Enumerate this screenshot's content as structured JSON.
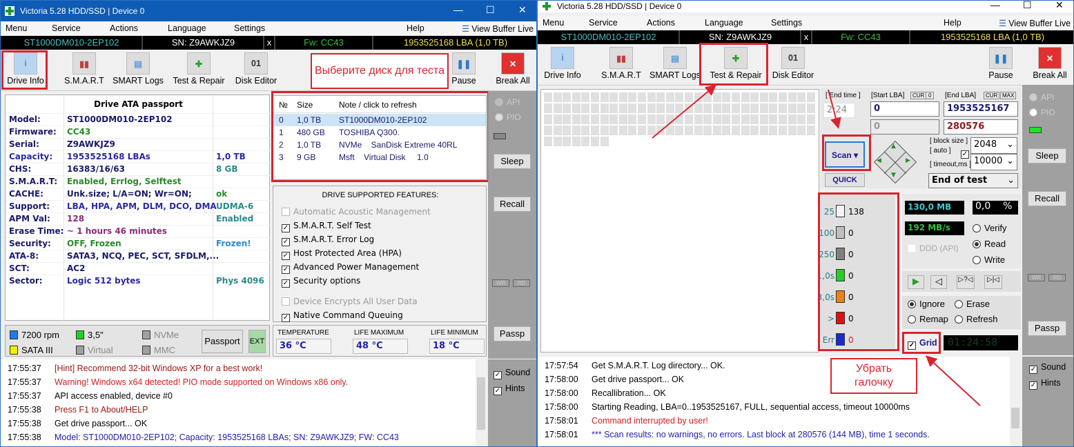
{
  "left": {
    "title": "Victoria 5.28 HDD/SSD | Device 0",
    "menu": [
      "Menu",
      "Service",
      "Actions",
      "Language",
      "Settings",
      "Help"
    ],
    "view_buffer": "View Buffer Live",
    "bar": {
      "model": "ST1000DM010-2EP102",
      "sn": "SN: Z9AWKJZ9",
      "x": "x",
      "fw": "Fw: CC43",
      "lba": "1953525168 LBA (1,0 TB)"
    },
    "toolbar": [
      "Drive Info",
      "S.M.A.R.T",
      "SMART Logs",
      "Test & Repair",
      "Disk Editor"
    ],
    "pause": "Pause",
    "break_all": "Break All",
    "annotation": "Выберите диск для теста",
    "passport": {
      "title": "Drive ATA passport",
      "rows": [
        {
          "k": "Model:",
          "v": "ST1000DM010-2EP102",
          "e": "",
          "kc": "#1a1a6a",
          "vc": "#1a1a6a",
          "ec": ""
        },
        {
          "k": "Firmware:",
          "v": "CC43",
          "e": "",
          "kc": "#1a1a6a",
          "vc": "#2a8a2a",
          "ec": ""
        },
        {
          "k": "Serial:",
          "v": "Z9AWKJZ9",
          "e": "",
          "kc": "#1a1a6a",
          "vc": "#1a1a6a",
          "ec": ""
        },
        {
          "k": "Capacity:",
          "v": "1953525168 LBAs",
          "e": "1,0 TB",
          "kc": "#2a2aa0",
          "vc": "#2a2aa0",
          "ec": "#2a2aa0"
        },
        {
          "k": "CHS:",
          "v": "16383/16/63",
          "e": "8 GB",
          "kc": "#1a1a6a",
          "vc": "#1a1a6a",
          "ec": "#2a8a8a"
        },
        {
          "k": "S.M.A.R.T:",
          "v": "Enabled, Errlog, Selftest",
          "e": "",
          "kc": "#1a1a6a",
          "vc": "#2a8a2a",
          "ec": ""
        },
        {
          "k": "CACHE:",
          "v": "Unk.size; L/A=ON; Wr=ON;",
          "e": "ok",
          "kc": "#1a1a6a",
          "vc": "#1a1a6a",
          "ec": "#2a8a2a"
        },
        {
          "k": "Support:",
          "v": "LBA, HPA, APM, DLM, DCO, DMA",
          "e": "UDMA-6",
          "kc": "#1a1a6a",
          "vc": "#2a2aa0",
          "ec": "#2a8a8a"
        },
        {
          "k": "APM Val:",
          "v": "128",
          "e": "Enabled",
          "kc": "#1a1a6a",
          "vc": "#8a2a7a",
          "ec": "#2a8a8a"
        },
        {
          "k": "Erase Time:",
          "v": "~ 1 hours 46 minutes",
          "e": "",
          "kc": "#1a1a6a",
          "vc": "#8a2a7a",
          "ec": ""
        },
        {
          "k": "Security:",
          "v": "OFF, Frozen",
          "e": "Frozen!",
          "kc": "#1a1a6a",
          "vc": "#2a8a2a",
          "ec": "#2a8ad0"
        },
        {
          "k": "ATA-8:",
          "v": "SATA3, NCQ, PEC, SCT, SFDLM,...",
          "e": "",
          "kc": "#1a1a6a",
          "vc": "#1a1a6a",
          "ec": ""
        },
        {
          "k": "SCT:",
          "v": "AC2",
          "e": "",
          "kc": "#1a1a6a",
          "vc": "#1a1a6a",
          "ec": ""
        },
        {
          "k": "Sector:",
          "v": "Logic 512 bytes",
          "e": "Phys 4096",
          "kc": "#1a1a6a",
          "vc": "#2a2aa0",
          "ec": "#2a8a8a"
        }
      ]
    },
    "disks": {
      "headers": [
        "№",
        "Size",
        "Note / click to refresh"
      ],
      "rows": [
        [
          "0",
          "1,0 TB",
          "ST1000DM010-2EP102"
        ],
        [
          "1",
          "480 GB",
          "TOSHIBA Q300."
        ],
        [
          "2",
          "1,0 TB",
          "NVMe    SanDisk Extreme 40RL"
        ],
        [
          "3",
          "9 GB",
          "Msft    Virtual Disk     1.0"
        ]
      ]
    },
    "features": {
      "title": "DRIVE SUPPORTED FEATURES:",
      "items": [
        {
          "label": "Automatic Acoustic Management",
          "checked": false,
          "enabled": false
        },
        {
          "label": "S.M.A.R.T. Self Test",
          "checked": true,
          "enabled": true
        },
        {
          "label": "S.M.A.R.T. Error Log",
          "checked": true,
          "enabled": true
        },
        {
          "label": "Host Protected Area (HPA)",
          "checked": true,
          "enabled": true
        },
        {
          "label": "Advanced Power Management",
          "checked": true,
          "enabled": true
        },
        {
          "label": "Security options",
          "checked": true,
          "enabled": true
        },
        {
          "label": "Device Encrypts All User Data",
          "checked": false,
          "enabled": false
        },
        {
          "label": "Native Command Queuing",
          "checked": true,
          "enabled": true
        }
      ]
    },
    "side": {
      "api": "API",
      "pio": "PIO",
      "sleep": "Sleep",
      "recall": "Recall",
      "wr": "WR",
      "rd": "RD",
      "passp": "Passp",
      "sound": "Sound",
      "hints": "Hints"
    },
    "legend": [
      {
        "label": "7200 rpm",
        "color": "#1e7be6"
      },
      {
        "label": "SATA III",
        "color": "#f0f000"
      },
      {
        "label": "3,5\"",
        "color": "#22d022"
      },
      {
        "label": "Virtual",
        "color": "#a0a0a0"
      },
      {
        "label": "NVMe",
        "color": "#a0a0a0"
      },
      {
        "label": "MMC",
        "color": "#a0a0a0"
      }
    ],
    "passport_btn": "Passport",
    "ext_btn": "EXT",
    "temps": [
      {
        "label": "TEMPERATURE",
        "value": "36 °C"
      },
      {
        "label": "LIFE MAXIMUM",
        "value": "48 °C"
      },
      {
        "label": "LIFE MINIMUM",
        "value": "18 °C"
      }
    ],
    "log": [
      {
        "t": "17:55:37",
        "m": "[Hint] Recommend 32-bit Windows XP for a best work!",
        "c": "#a01818"
      },
      {
        "t": "17:55:37",
        "m": "Warning! Windows x64 detected! PIO mode supported on Windows x86 only.",
        "c": "#d02020"
      },
      {
        "t": "17:55:37",
        "m": "API access enabled, device #0",
        "c": "#000"
      },
      {
        "t": "17:55:38",
        "m": "Press F1 to About/HELP",
        "c": "#a01818"
      },
      {
        "t": "17:55:38",
        "m": "Get drive passport... OK",
        "c": "#000"
      },
      {
        "t": "17:55:38",
        "m": "Model: ST1000DM010-2EP102; Capacity: 1953525168 LBAs; SN: Z9AWKJZ9; FW: CC43",
        "c": "#2020b0"
      }
    ]
  },
  "right": {
    "title": "Victoria 5.28 HDD/SSD | Device 0",
    "menu": [
      "Menu",
      "Service",
      "Actions",
      "Language",
      "Settings",
      "Help"
    ],
    "view_buffer": "View Buffer Live",
    "bar": {
      "model": "ST1000DM010-2EP102",
      "sn": "SN: Z9AWKJZ9",
      "x": "x",
      "fw": "Fw: CC43",
      "lba": "1953525168 LBA (1,0 TB)"
    },
    "toolbar": [
      "Drive Info",
      "S.M.A.R.T",
      "SMART Logs",
      "Test & Repair",
      "Disk Editor"
    ],
    "pause": "Pause",
    "break_all": "Break All",
    "end_time_label": "[ End time ]",
    "end_time": "2:24",
    "start_lba_label": "[Start LBA]",
    "cur": "CUR",
    "zero": "0",
    "end_lba_label": "[End LBA]",
    "max": "MAX",
    "start_lba": "0",
    "end_lba": "1953525167",
    "cur_lba": "0",
    "cur_end": "280576",
    "scan": "Scan",
    "quick": "QUICK",
    "block_size_label": "[ block size ]",
    "auto_label": "[ auto ]",
    "timeout_label": "[ timeout,ms ]",
    "block_size": "2048",
    "timeout": "10000",
    "end_action": "End of test",
    "legend": [
      {
        "label": "25",
        "count": "138",
        "color": "#f4f4f4"
      },
      {
        "label": "100",
        "count": "0",
        "color": "#c0c0c0"
      },
      {
        "label": "250",
        "count": "0",
        "color": "#808080"
      },
      {
        "label": "1,0s",
        "count": "0",
        "color": "#22d022"
      },
      {
        "label": "3,0s",
        "count": "0",
        "color": "#f08010"
      },
      {
        "label": ">",
        "count": "0",
        "color": "#e01010"
      },
      {
        "label": "Err",
        "count": "0",
        "color": "#1a2ad0"
      }
    ],
    "mb": "130,0 MB",
    "percent": "0,0    %",
    "speed": "192 MB/s",
    "ddd": "DDD (API)",
    "modes": [
      {
        "label": "Verify",
        "on": false
      },
      {
        "label": "Read",
        "on": true
      },
      {
        "label": "Write",
        "on": false
      }
    ],
    "actions": [
      {
        "label": "Ignore",
        "on": true
      },
      {
        "label": "Erase",
        "on": false
      },
      {
        "label": "Remap",
        "on": false
      },
      {
        "label": "Refresh",
        "on": false
      }
    ],
    "grid": "Grid",
    "timer": "01:24:58",
    "annotation": "Убрать галочку",
    "side": {
      "api": "API",
      "pio": "PIO",
      "sleep": "Sleep",
      "recall": "Recall",
      "wr": "WR",
      "rd": "RD",
      "passp": "Passp",
      "sound": "Sound",
      "hints": "Hints"
    },
    "log": [
      {
        "t": "17:57:54",
        "m": "Get S.M.A.R.T. Log directory... OK.",
        "c": "#000"
      },
      {
        "t": "17:58:00",
        "m": "Get drive passport... OK",
        "c": "#000"
      },
      {
        "t": "17:58:00",
        "m": "Recallibration... OK",
        "c": "#000"
      },
      {
        "t": "17:58:00",
        "m": "Starting Reading, LBA=0..1953525167, FULL, sequential access, timeout 10000ms",
        "c": "#000"
      },
      {
        "t": "17:58:01",
        "m": "Command interrupted by user!",
        "c": "#d02020"
      },
      {
        "t": "17:58:01",
        "m": "*** Scan results: no warnings, no errors. Last block at 280576 (144 MB), time 1 seconds.",
        "c": "#2020b0"
      }
    ]
  }
}
